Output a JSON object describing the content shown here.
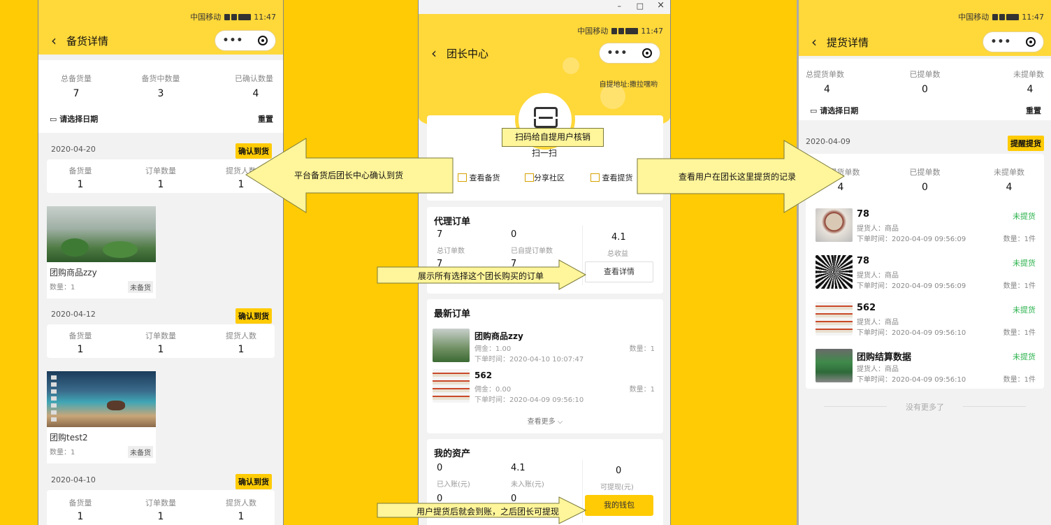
{
  "status_bar": {
    "carrier": "中国移动",
    "time": "11:47"
  },
  "left": {
    "nav_title": "备货详情",
    "summary": [
      {
        "label": "总备货量",
        "value": "7"
      },
      {
        "label": "备货中数量",
        "value": "3"
      },
      {
        "label": "已确认数量",
        "value": "4"
      }
    ],
    "date_select": "请选择日期",
    "reset": "重置",
    "groups": [
      {
        "date": "2020-04-20",
        "badge": "确认到货",
        "stats": [
          {
            "label": "备货量",
            "value": "1"
          },
          {
            "label": "订单数量",
            "value": "1"
          },
          {
            "label": "提货人数",
            "value": "1"
          }
        ],
        "product": {
          "name": "团购商品zzy",
          "qty": "数量：1",
          "status": "未备货"
        }
      },
      {
        "date": "2020-04-12",
        "badge": "确认到货",
        "stats": [
          {
            "label": "备货量",
            "value": "1"
          },
          {
            "label": "订单数量",
            "value": "1"
          },
          {
            "label": "提货人数",
            "value": "1"
          }
        ],
        "product": {
          "name": "团购test2",
          "qty": "数量：1",
          "status": "未备货"
        }
      },
      {
        "date": "2020-04-10",
        "badge": "确认到货",
        "stats": [
          {
            "label": "备货量",
            "value": "1"
          },
          {
            "label": "订单数量",
            "value": "1"
          },
          {
            "label": "提货人数",
            "value": "1"
          }
        ]
      }
    ]
  },
  "middle": {
    "window_controls": {
      "minimize": "–",
      "maximize": "□",
      "close": "×"
    },
    "nav_title": "团长中心",
    "address": "自提地址:撒拉嘿哟",
    "scan_label": "扫一扫",
    "actions": [
      "查看备货",
      "分享社区",
      "查看提货"
    ],
    "agent_orders": {
      "title": "代理订单",
      "total_orders": {
        "value": "7",
        "label": "总订单数"
      },
      "self_pickup": {
        "value": "0",
        "label": "已自提订单数"
      },
      "row2_left": "7",
      "row2_mid": "7",
      "income": {
        "value": "4.1",
        "label": "总收益"
      },
      "detail_button": "查看详情"
    },
    "latest_orders": {
      "title": "最新订单",
      "items": [
        {
          "name": "团购商品zzy",
          "commission": "佣金：1.00",
          "time": "下单时间：2020-04-10 10:07:47",
          "qty": "数量：1"
        },
        {
          "name": "562",
          "commission": "佣金：0.00",
          "time": "下单时间：2020-04-09 09:56:10",
          "qty": "数量：1"
        }
      ],
      "more": "查看更多"
    },
    "assets": {
      "title": "我的资产",
      "credited": {
        "value": "0",
        "label": "已入账(元)"
      },
      "pending": {
        "value": "4.1",
        "label": "未入账(元)"
      },
      "withdrawable": {
        "value": "0",
        "label": "可提现(元)"
      },
      "row2_left": "0",
      "row2_mid": "0",
      "wallet_button": "我的钱包"
    }
  },
  "right": {
    "nav_title": "提货详情",
    "summary": [
      {
        "label": "总提货单数",
        "value": "4"
      },
      {
        "label": "已提单数",
        "value": "0"
      },
      {
        "label": "未提单数",
        "value": "4"
      }
    ],
    "date_select": "请选择日期",
    "reset": "重置",
    "group_date": "2020-04-09",
    "group_badge": "提醒提货",
    "group_stats": [
      {
        "label": "总提货单数",
        "value": "4"
      },
      {
        "label": "已提单数",
        "value": "0"
      },
      {
        "label": "未提单数",
        "value": "4"
      }
    ],
    "records": [
      {
        "title": "78",
        "picker": "提货人：商品",
        "time": "下单时间：2020-04-09 09:56:09",
        "status": "未提货",
        "qty": "数量：1件"
      },
      {
        "title": "78",
        "picker": "提货人：商品",
        "time": "下单时间：2020-04-09 09:56:09",
        "status": "未提货",
        "qty": "数量：1件"
      },
      {
        "title": "562",
        "picker": "提货人：商品",
        "time": "下单时间：2020-04-09 09:56:10",
        "status": "未提货",
        "qty": "数量：1件"
      },
      {
        "title": "团购结算数据",
        "picker": "提货人：商品",
        "time": "下单时间：2020-04-09 09:56:10",
        "status": "未提货",
        "qty": "数量：1件"
      }
    ],
    "no_more": "没有更多了"
  },
  "callouts": {
    "left_arrow": "平台备货后团长中心确认到货",
    "right_arrow": "查看用户在团长这里提货的记录",
    "scan": "扫码给自提用户核销",
    "orders": "展示所有选择这个团长购买的订单",
    "wallet": "用户提货后就会到账，之后团长可提现"
  },
  "colors": {
    "background": "#FFCB05",
    "header": "#FFD83A",
    "callout": "#FFF59A",
    "pending_status": "#2bb24c"
  }
}
